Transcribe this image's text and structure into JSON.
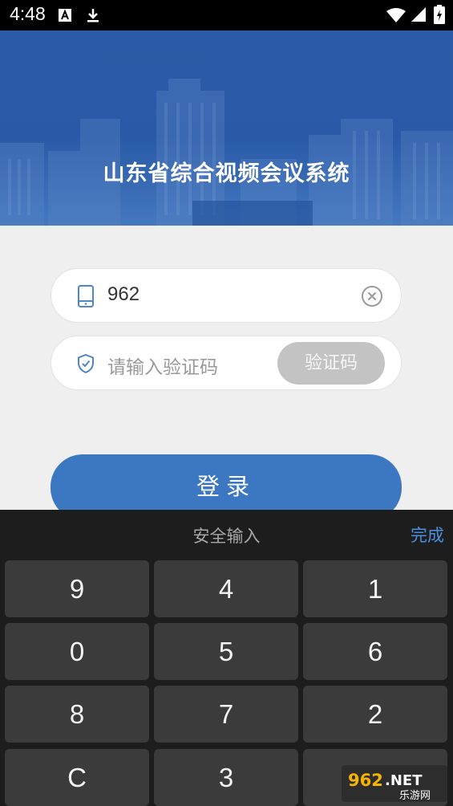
{
  "status_bar": {
    "time": "4:48",
    "icons": [
      "text-a-icon",
      "download-icon",
      "wifi-icon",
      "signal-icon",
      "battery-icon"
    ]
  },
  "banner": {
    "title": "山东省综合视频会议系统"
  },
  "login_form": {
    "phone": {
      "value": "962",
      "icon": "phone-icon"
    },
    "code": {
      "placeholder": "请输入验证码",
      "button_label": "验证码",
      "icon": "shield-icon"
    },
    "login_label": "登录"
  },
  "keyboard": {
    "title": "安全输入",
    "done_label": "完成",
    "keys": [
      [
        "9",
        "4",
        "1"
      ],
      [
        "0",
        "5",
        "6"
      ],
      [
        "8",
        "7",
        "2"
      ],
      [
        "C",
        "3",
        ""
      ]
    ]
  },
  "watermark": {
    "text": "962.NET",
    "subtext": "乐游网"
  },
  "colors": {
    "banner": "#2c5ba9",
    "login_button": "#3c77c2",
    "code_button": "#c3c3c3",
    "keyboard_bg": "#1d1d1d",
    "key_bg": "#3b3b3b",
    "done": "#4a90e2"
  }
}
